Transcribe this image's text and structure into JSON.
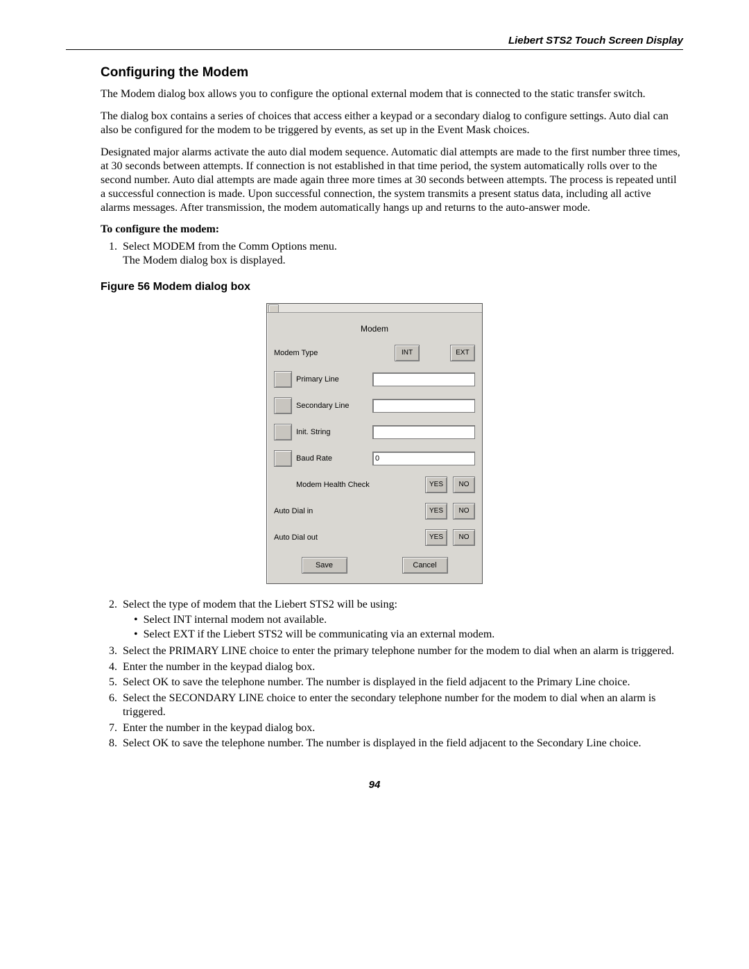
{
  "header": {
    "running_head": "Liebert STS2 Touch Screen Display"
  },
  "section": {
    "heading": "Configuring the Modem",
    "p1": "The Modem dialog box allows you to configure the optional external modem that is connected to the static transfer switch.",
    "p2": "The dialog box contains a series of choices that access either a keypad or a secondary dialog to configure settings. Auto dial can also be configured for the modem to be triggered by events, as set up in the Event Mask choices.",
    "p3": "Designated major alarms activate the auto dial modem sequence. Automatic dial attempts are made to the first number three times, at 30 seconds between attempts. If connection is not established in that time period, the system automatically rolls over to the second number. Auto dial attempts are made again three more times at 30 seconds between attempts. The process is repeated until a successful connection is made. Upon successful connection, the system transmits a present status data, including all active alarms messages. After transmission, the modem automatically hangs up and returns to the auto-answer mode.",
    "subhead_configure": "To configure the modem:",
    "step1a": "Select MODEM from the Comm Options menu.",
    "step1b": "The Modem dialog box is displayed.",
    "figure_caption": "Figure 56  Modem dialog box",
    "step2": "Select the type of modem that the Liebert STS2 will be using:",
    "step2_b1": "Select INT internal modem not available.",
    "step2_b2": "Select EXT if the Liebert STS2 will be communicating via an external modem.",
    "step3": "Select the PRIMARY LINE choice to enter the primary telephone number for the modem to dial when an alarm is triggered.",
    "step4": "Enter the number in the keypad dialog box.",
    "step5": "Select OK to save the telephone number. The number is displayed in the field adjacent to the Primary Line choice.",
    "step6": "Select the SECONDARY LINE choice to enter the secondary telephone number for the modem to dial when an alarm is triggered.",
    "step7": "Enter the number in the keypad dialog box.",
    "step8": "Select OK to save the telephone number. The number is displayed in the field adjacent to the Secondary Line choice."
  },
  "dialog": {
    "title": "Modem",
    "modem_type_label": "Modem Type",
    "int_btn": "INT",
    "ext_btn": "EXT",
    "primary_line_label": "Primary Line",
    "secondary_line_label": "Secondary Line",
    "init_string_label": "Init. String",
    "baud_rate_label": "Baud Rate",
    "baud_rate_value": "0",
    "health_check_label": "Modem Health Check",
    "yes": "YES",
    "no": "NO",
    "auto_dial_in_label": "Auto Dial in",
    "auto_dial_out_label": "Auto Dial out",
    "save": "Save",
    "cancel": "Cancel"
  },
  "footer": {
    "page_number": "94"
  }
}
